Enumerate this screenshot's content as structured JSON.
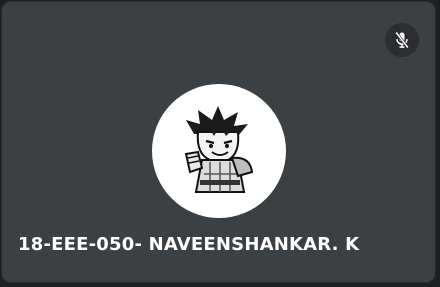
{
  "participant": {
    "name": "18-EEE-050- NAVEENSHANKAR. K",
    "avatar_icon": "cartoon-character-avatar",
    "mic_status_icon": "mic-off-icon"
  },
  "colors": {
    "tile_background": "#3c4043",
    "page_background": "#1e1f21",
    "avatar_background": "#ffffff",
    "badge_background": "#2b2d30",
    "name_text": "#ffffff"
  }
}
